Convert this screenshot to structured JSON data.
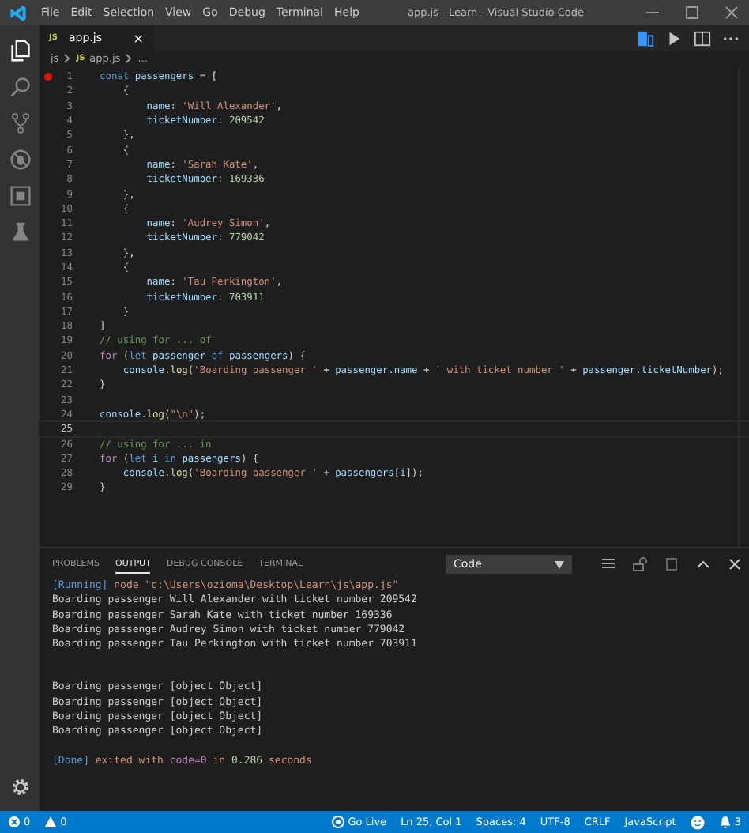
{
  "window": {
    "title": "app.js - Learn - Visual Studio Code"
  },
  "menu": [
    "File",
    "Edit",
    "Selection",
    "View",
    "Go",
    "Debug",
    "Terminal",
    "Help"
  ],
  "activity_bar": [
    {
      "kind": "files",
      "selected": true
    },
    {
      "kind": "search",
      "selected": false
    },
    {
      "kind": "branch",
      "selected": false
    },
    {
      "kind": "debug",
      "selected": false
    },
    {
      "kind": "extensions",
      "selected": false
    },
    {
      "kind": "flask",
      "selected": false
    }
  ],
  "editor_tab": {
    "badge": "JS",
    "label": "app.js",
    "close": "×"
  },
  "breadcrumb": [
    {
      "label": "js"
    },
    {
      "badge": "JS",
      "label": "app.js"
    },
    {
      "label": "…"
    }
  ],
  "code_lines": [
    {
      "number": "1",
      "breakpoint": true,
      "current": false,
      "tokens": [
        {
          "kind": "kw",
          "text": "const "
        },
        {
          "kind": "var",
          "text": "passengers"
        },
        {
          "kind": "p",
          "text": " = ["
        }
      ]
    },
    {
      "number": "2",
      "breakpoint": false,
      "current": false,
      "tokens": [
        {
          "kind": "p",
          "text": "    {"
        }
      ]
    },
    {
      "number": "3",
      "breakpoint": false,
      "current": false,
      "tokens": [
        {
          "kind": "var",
          "text": "        name"
        },
        {
          "kind": "p",
          "text": ": "
        },
        {
          "kind": "str",
          "text": "'Will Alexander'"
        },
        {
          "kind": "p",
          "text": ","
        }
      ]
    },
    {
      "number": "4",
      "breakpoint": false,
      "current": false,
      "tokens": [
        {
          "kind": "var",
          "text": "        ticketNumber"
        },
        {
          "kind": "p",
          "text": ": "
        },
        {
          "kind": "num",
          "text": "209542"
        }
      ]
    },
    {
      "number": "5",
      "breakpoint": false,
      "current": false,
      "tokens": [
        {
          "kind": "p",
          "text": "    },"
        }
      ]
    },
    {
      "number": "6",
      "breakpoint": false,
      "current": false,
      "tokens": [
        {
          "kind": "p",
          "text": "    {"
        }
      ]
    },
    {
      "number": "7",
      "breakpoint": false,
      "current": false,
      "tokens": [
        {
          "kind": "var",
          "text": "        name"
        },
        {
          "kind": "p",
          "text": ": "
        },
        {
          "kind": "str",
          "text": "'Sarah Kate'"
        },
        {
          "kind": "p",
          "text": ","
        }
      ]
    },
    {
      "number": "8",
      "breakpoint": false,
      "current": false,
      "tokens": [
        {
          "kind": "var",
          "text": "        ticketNumber"
        },
        {
          "kind": "p",
          "text": ": "
        },
        {
          "kind": "num",
          "text": "169336"
        }
      ]
    },
    {
      "number": "9",
      "breakpoint": false,
      "current": false,
      "tokens": [
        {
          "kind": "p",
          "text": "    },"
        }
      ]
    },
    {
      "number": "10",
      "breakpoint": false,
      "current": false,
      "tokens": [
        {
          "kind": "p",
          "text": "    {"
        }
      ]
    },
    {
      "number": "11",
      "breakpoint": false,
      "current": false,
      "tokens": [
        {
          "kind": "var",
          "text": "        name"
        },
        {
          "kind": "p",
          "text": ": "
        },
        {
          "kind": "str",
          "text": "'Audrey Simon'"
        },
        {
          "kind": "p",
          "text": ","
        }
      ]
    },
    {
      "number": "12",
      "breakpoint": false,
      "current": false,
      "tokens": [
        {
          "kind": "var",
          "text": "        ticketNumber"
        },
        {
          "kind": "p",
          "text": ": "
        },
        {
          "kind": "num",
          "text": "779042"
        }
      ]
    },
    {
      "number": "13",
      "breakpoint": false,
      "current": false,
      "tokens": [
        {
          "kind": "p",
          "text": "    },"
        }
      ]
    },
    {
      "number": "14",
      "breakpoint": false,
      "current": false,
      "tokens": [
        {
          "kind": "p",
          "text": "    {"
        }
      ]
    },
    {
      "number": "15",
      "breakpoint": false,
      "current": false,
      "tokens": [
        {
          "kind": "var",
          "text": "        name"
        },
        {
          "kind": "p",
          "text": ": "
        },
        {
          "kind": "str",
          "text": "'Tau Perkington'"
        },
        {
          "kind": "p",
          "text": ","
        }
      ]
    },
    {
      "number": "16",
      "breakpoint": false,
      "current": false,
      "tokens": [
        {
          "kind": "var",
          "text": "        ticketNumber"
        },
        {
          "kind": "p",
          "text": ": "
        },
        {
          "kind": "num",
          "text": "703911"
        }
      ]
    },
    {
      "number": "17",
      "breakpoint": false,
      "current": false,
      "tokens": [
        {
          "kind": "p",
          "text": "    }"
        }
      ]
    },
    {
      "number": "18",
      "breakpoint": false,
      "current": false,
      "tokens": [
        {
          "kind": "p",
          "text": "]"
        }
      ]
    },
    {
      "number": "19",
      "breakpoint": false,
      "current": false,
      "tokens": [
        {
          "kind": "comment",
          "text": "// using for ... of"
        }
      ]
    },
    {
      "number": "20",
      "breakpoint": false,
      "current": false,
      "tokens": [
        {
          "kind": "ctrl",
          "text": "for"
        },
        {
          "kind": "p",
          "text": " ("
        },
        {
          "kind": "kw",
          "text": "let"
        },
        {
          "kind": "var",
          "text": " passenger"
        },
        {
          "kind": "kw",
          "text": " of"
        },
        {
          "kind": "var",
          "text": " passengers"
        },
        {
          "kind": "p",
          "text": ") {"
        }
      ]
    },
    {
      "number": "21",
      "breakpoint": false,
      "current": false,
      "tokens": [
        {
          "kind": "var",
          "text": "    console"
        },
        {
          "kind": "p",
          "text": "."
        },
        {
          "kind": "fn",
          "text": "log"
        },
        {
          "kind": "p",
          "text": "("
        },
        {
          "kind": "str",
          "text": "'Boarding passenger '"
        },
        {
          "kind": "p",
          "text": " + "
        },
        {
          "kind": "var",
          "text": "passenger.name"
        },
        {
          "kind": "p",
          "text": " + "
        },
        {
          "kind": "str",
          "text": "' with ticket number '"
        },
        {
          "kind": "p",
          "text": " + "
        },
        {
          "kind": "var",
          "text": "passenger.ticketNumber"
        },
        {
          "kind": "p",
          "text": ");"
        }
      ]
    },
    {
      "number": "22",
      "breakpoint": false,
      "current": false,
      "tokens": [
        {
          "kind": "p",
          "text": "}"
        }
      ]
    },
    {
      "number": "23",
      "breakpoint": false,
      "current": false
    },
    {
      "number": "24",
      "breakpoint": false,
      "current": false,
      "tokens": [
        {
          "kind": "var",
          "text": "console"
        },
        {
          "kind": "p",
          "text": "."
        },
        {
          "kind": "fn",
          "text": "log"
        },
        {
          "kind": "p",
          "text": "("
        },
        {
          "kind": "str",
          "text": "\"\\n\""
        },
        {
          "kind": "p",
          "text": ");"
        }
      ]
    },
    {
      "number": "25",
      "breakpoint": false,
      "current": true
    },
    {
      "number": "26",
      "breakpoint": false,
      "current": false,
      "tokens": [
        {
          "kind": "comment",
          "text": "// using for ... in"
        }
      ]
    },
    {
      "number": "27",
      "breakpoint": false,
      "current": false,
      "tokens": [
        {
          "kind": "ctrl",
          "text": "for"
        },
        {
          "kind": "p",
          "text": " ("
        },
        {
          "kind": "kw",
          "text": "let"
        },
        {
          "kind": "var",
          "text": " i"
        },
        {
          "kind": "kw",
          "text": " in"
        },
        {
          "kind": "var",
          "text": " passengers"
        },
        {
          "kind": "p",
          "text": ") {"
        }
      ]
    },
    {
      "number": "28",
      "breakpoint": false,
      "current": false,
      "tokens": [
        {
          "kind": "var",
          "text": "    console"
        },
        {
          "kind": "p",
          "text": "."
        },
        {
          "kind": "fn",
          "text": "log"
        },
        {
          "kind": "p",
          "text": "("
        },
        {
          "kind": "str",
          "text": "'Boarding passenger '"
        },
        {
          "kind": "p",
          "text": " + "
        },
        {
          "kind": "var",
          "text": "passengers"
        },
        {
          "kind": "p",
          "text": "["
        },
        {
          "kind": "var",
          "text": "i"
        },
        {
          "kind": "p",
          "text": "]);"
        }
      ]
    },
    {
      "number": "29",
      "breakpoint": false,
      "current": false,
      "tokens": [
        {
          "kind": "p",
          "text": "}"
        }
      ]
    }
  ],
  "panel": {
    "tabs": [
      {
        "label": "PROBLEMS",
        "selected": false
      },
      {
        "label": "OUTPUT",
        "selected": true
      },
      {
        "label": "DEBUG CONSOLE",
        "selected": false
      },
      {
        "label": "TERMINAL",
        "selected": false
      }
    ],
    "channel": "Code",
    "output_blocks": [
      [
        [
          {
            "kind": "tag",
            "text": "[Running]"
          },
          {
            "kind": "cmd",
            "text": " node \"c:\\Users\\ozioma\\Desktop\\Learn\\js\\app.js\""
          }
        ],
        [
          {
            "kind": "p",
            "text": "Boarding passenger Will Alexander with ticket number 209542"
          }
        ],
        [
          {
            "kind": "p",
            "text": "Boarding passenger Sarah Kate with ticket number 169336"
          }
        ],
        [
          {
            "kind": "p",
            "text": "Boarding passenger Audrey Simon with ticket number 779042"
          }
        ],
        [
          {
            "kind": "p",
            "text": "Boarding passenger Tau Perkington with ticket number 703911"
          }
        ]
      ],
      [
        [
          {
            "kind": "p",
            "text": "Boarding passenger [object Object]"
          }
        ],
        [
          {
            "kind": "p",
            "text": "Boarding passenger [object Object]"
          }
        ],
        [
          {
            "kind": "p",
            "text": "Boarding passenger [object Object]"
          }
        ],
        [
          {
            "kind": "p",
            "text": "Boarding passenger [object Object]"
          }
        ]
      ],
      [
        [
          {
            "kind": "tag",
            "text": "[Done]"
          },
          {
            "kind": "cmd",
            "text": " exited with "
          },
          {
            "kind": "code",
            "text": "code=0"
          },
          {
            "kind": "cmd",
            "text": " in "
          },
          {
            "kind": "num",
            "text": "0.286"
          },
          {
            "kind": "cmd",
            "text": " seconds"
          }
        ]
      ]
    ]
  },
  "status_bar": {
    "errors": "0",
    "warnings": "0",
    "right": [
      {
        "kind": "golive",
        "text": "Go Live"
      },
      {
        "kind": "text",
        "text": "Ln 25, Col 1"
      },
      {
        "kind": "text",
        "text": "Spaces: 4"
      },
      {
        "kind": "text",
        "text": "UTF-8"
      },
      {
        "kind": "text",
        "text": "CRLF"
      },
      {
        "kind": "text",
        "text": "JavaScript"
      },
      {
        "kind": "smiley"
      },
      {
        "kind": "bell",
        "text": "3"
      }
    ]
  }
}
